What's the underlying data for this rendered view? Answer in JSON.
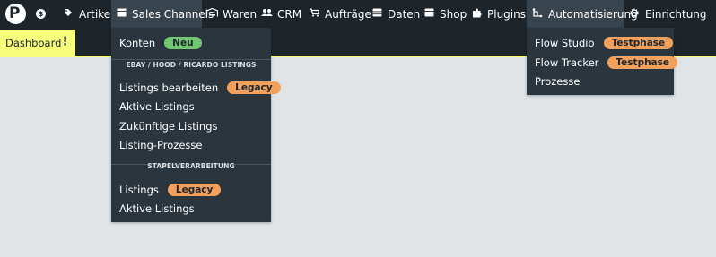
{
  "nav": {
    "items": [
      {
        "label": "",
        "icon": "dollar-circle-icon"
      },
      {
        "label": "Artikel",
        "icon": "tag-icon"
      },
      {
        "label": "Sales Channels",
        "icon": "store-icon"
      },
      {
        "label": "Waren",
        "icon": "warehouse-icon"
      },
      {
        "label": "CRM",
        "icon": "users-icon"
      },
      {
        "label": "Aufträge",
        "icon": "cart-icon"
      },
      {
        "label": "Daten",
        "icon": "database-icon"
      },
      {
        "label": "Shop",
        "icon": "shop-icon"
      },
      {
        "label": "Plugins",
        "icon": "puzzle-icon"
      },
      {
        "label": "Automatisierung",
        "icon": "flow-icon"
      },
      {
        "label": "Einrichtung",
        "icon": "gear-icon"
      }
    ]
  },
  "dashboard_tab": {
    "label": "Dashboard",
    "menu_icon": "more-vertical-icon"
  },
  "sales_menu": {
    "konten": {
      "label": "Konten",
      "badge": "Neu"
    },
    "section1": "EBAY / HOOD / RICARDO LISTINGS",
    "items1": [
      {
        "label": "Listings bearbeiten",
        "badge": "Legacy"
      },
      {
        "label": "Aktive Listings"
      },
      {
        "label": "Zukünftige Listings"
      },
      {
        "label": "Listing-Prozesse"
      }
    ],
    "section2": "STAPELVERARBEITUNG",
    "items2": [
      {
        "label": "Listings",
        "badge": "Legacy"
      },
      {
        "label": "Aktive Listings"
      }
    ]
  },
  "auto_menu": {
    "items": [
      {
        "label": "Flow Studio",
        "badge": "Testphase"
      },
      {
        "label": "Flow Tracker",
        "badge": "Testphase"
      },
      {
        "label": "Prozesse"
      }
    ]
  },
  "colors": {
    "topbar": "#1d252b",
    "active": "#38444e",
    "dropdown": "#2b353d",
    "accent_yellow": "#f6fe7c",
    "badge_green": "#6fc76f",
    "badge_orange": "#f2a05c",
    "background": "#e1e4e7"
  }
}
